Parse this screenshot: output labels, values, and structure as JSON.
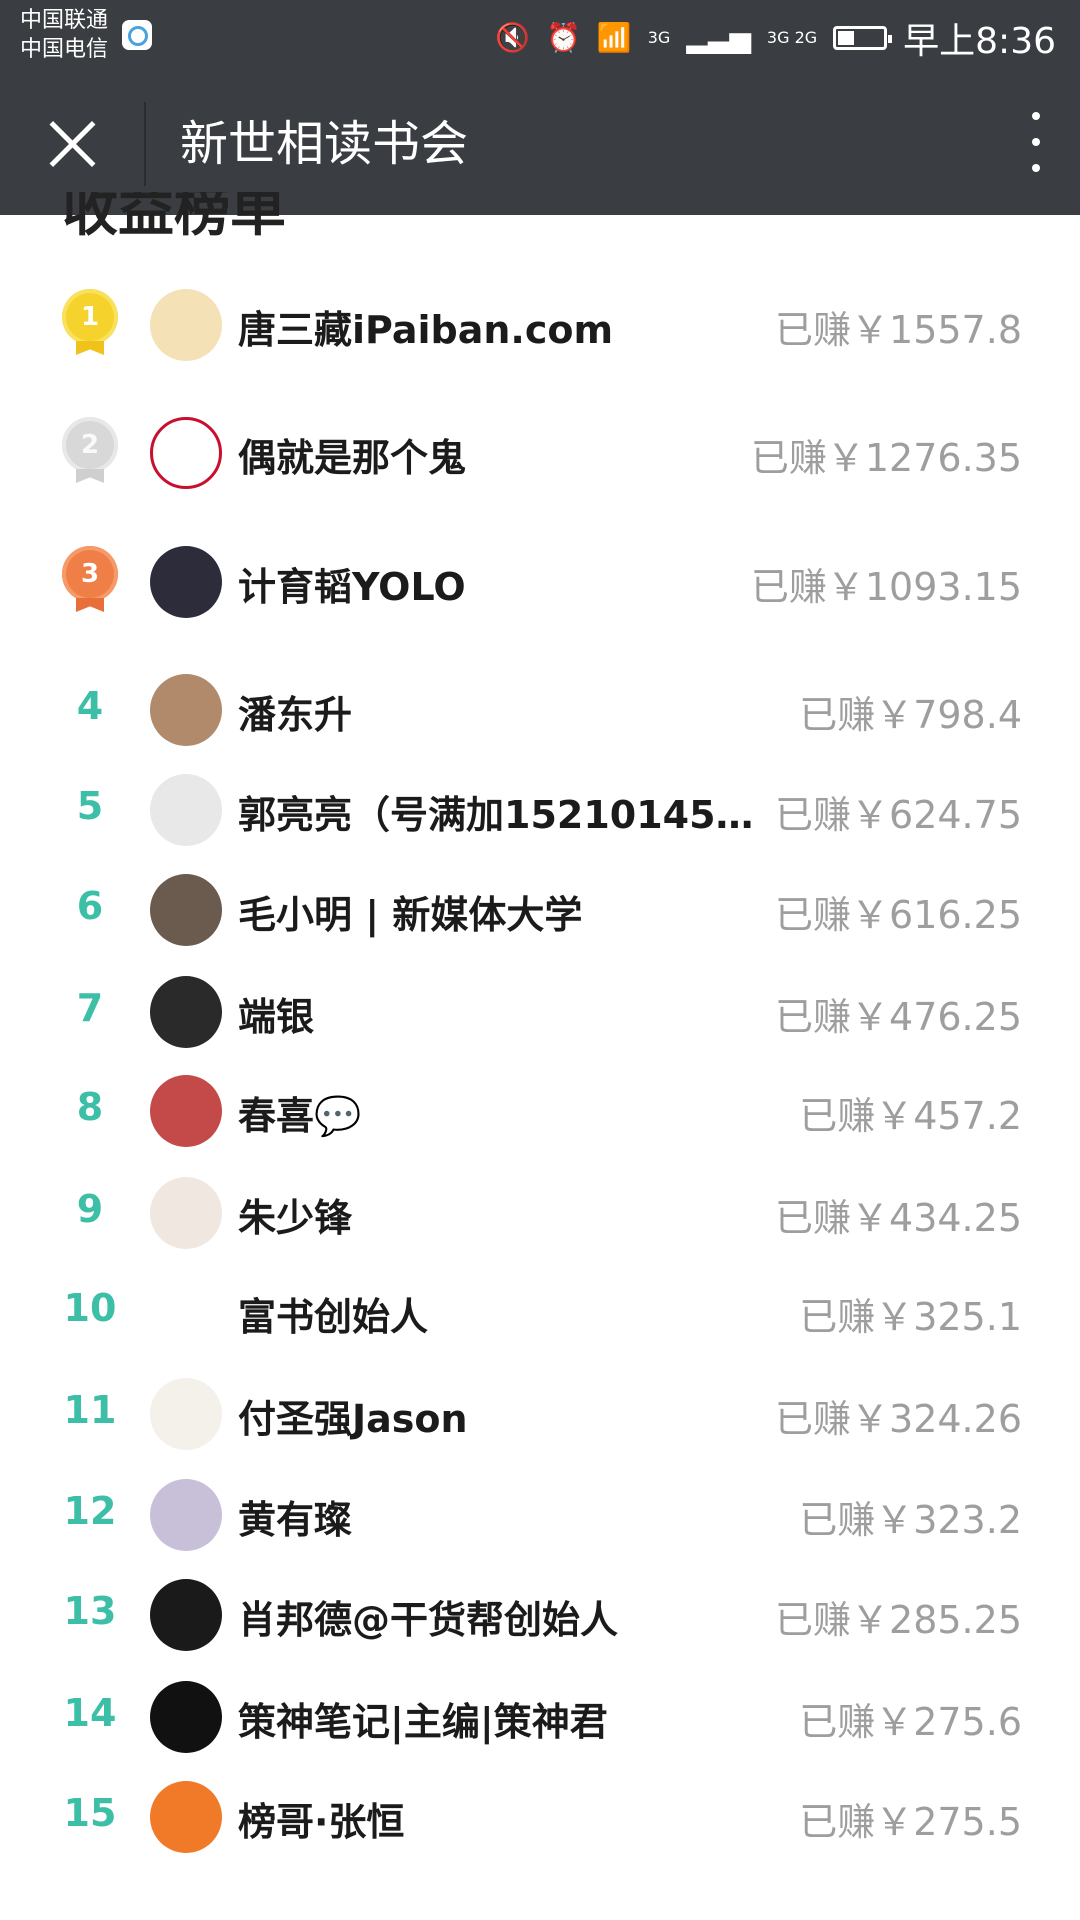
{
  "status_bar": {
    "carrier_1": "中国联通",
    "carrier_2": "中国电信",
    "network_1": "3G",
    "network_2": "3G 2G",
    "time": "早上8:36"
  },
  "header": {
    "title": "新世相读书会"
  },
  "section": {
    "title": "收益榜单"
  },
  "earned_prefix": "已赚￥",
  "accent_color": "#3dbfa7",
  "leaderboard": [
    {
      "rank": "1",
      "name": "唐三藏iPaiban.com",
      "amount": "1557.8",
      "medal": "gold"
    },
    {
      "rank": "2",
      "name": "偶就是那个鬼",
      "amount": "1276.35",
      "medal": "silver"
    },
    {
      "rank": "3",
      "name": "计育韬YOLO",
      "amount": "1093.15",
      "medal": "bronze"
    },
    {
      "rank": "4",
      "name": "潘东升",
      "amount": "798.4"
    },
    {
      "rank": "5",
      "name": "郭亮亮（号满加152101450...",
      "amount": "624.75"
    },
    {
      "rank": "6",
      "name": "毛小明 | 新媒体大学",
      "amount": "616.25"
    },
    {
      "rank": "7",
      "name": "端银",
      "amount": "476.25"
    },
    {
      "rank": "8",
      "name": "春喜💬",
      "amount": "457.2"
    },
    {
      "rank": "9",
      "name": "朱少锋",
      "amount": "434.25"
    },
    {
      "rank": "10",
      "name": "富书创始人",
      "amount": "325.1"
    },
    {
      "rank": "11",
      "name": "付圣强Jason",
      "amount": "324.26"
    },
    {
      "rank": "12",
      "name": "黄有璨",
      "amount": "323.2"
    },
    {
      "rank": "13",
      "name": "肖邦德@干货帮创始人",
      "amount": "285.25"
    },
    {
      "rank": "14",
      "name": "策神笔记|主编|策神君",
      "amount": "275.6"
    },
    {
      "rank": "15",
      "name": "榜哥·张恒",
      "amount": "275.5"
    }
  ]
}
